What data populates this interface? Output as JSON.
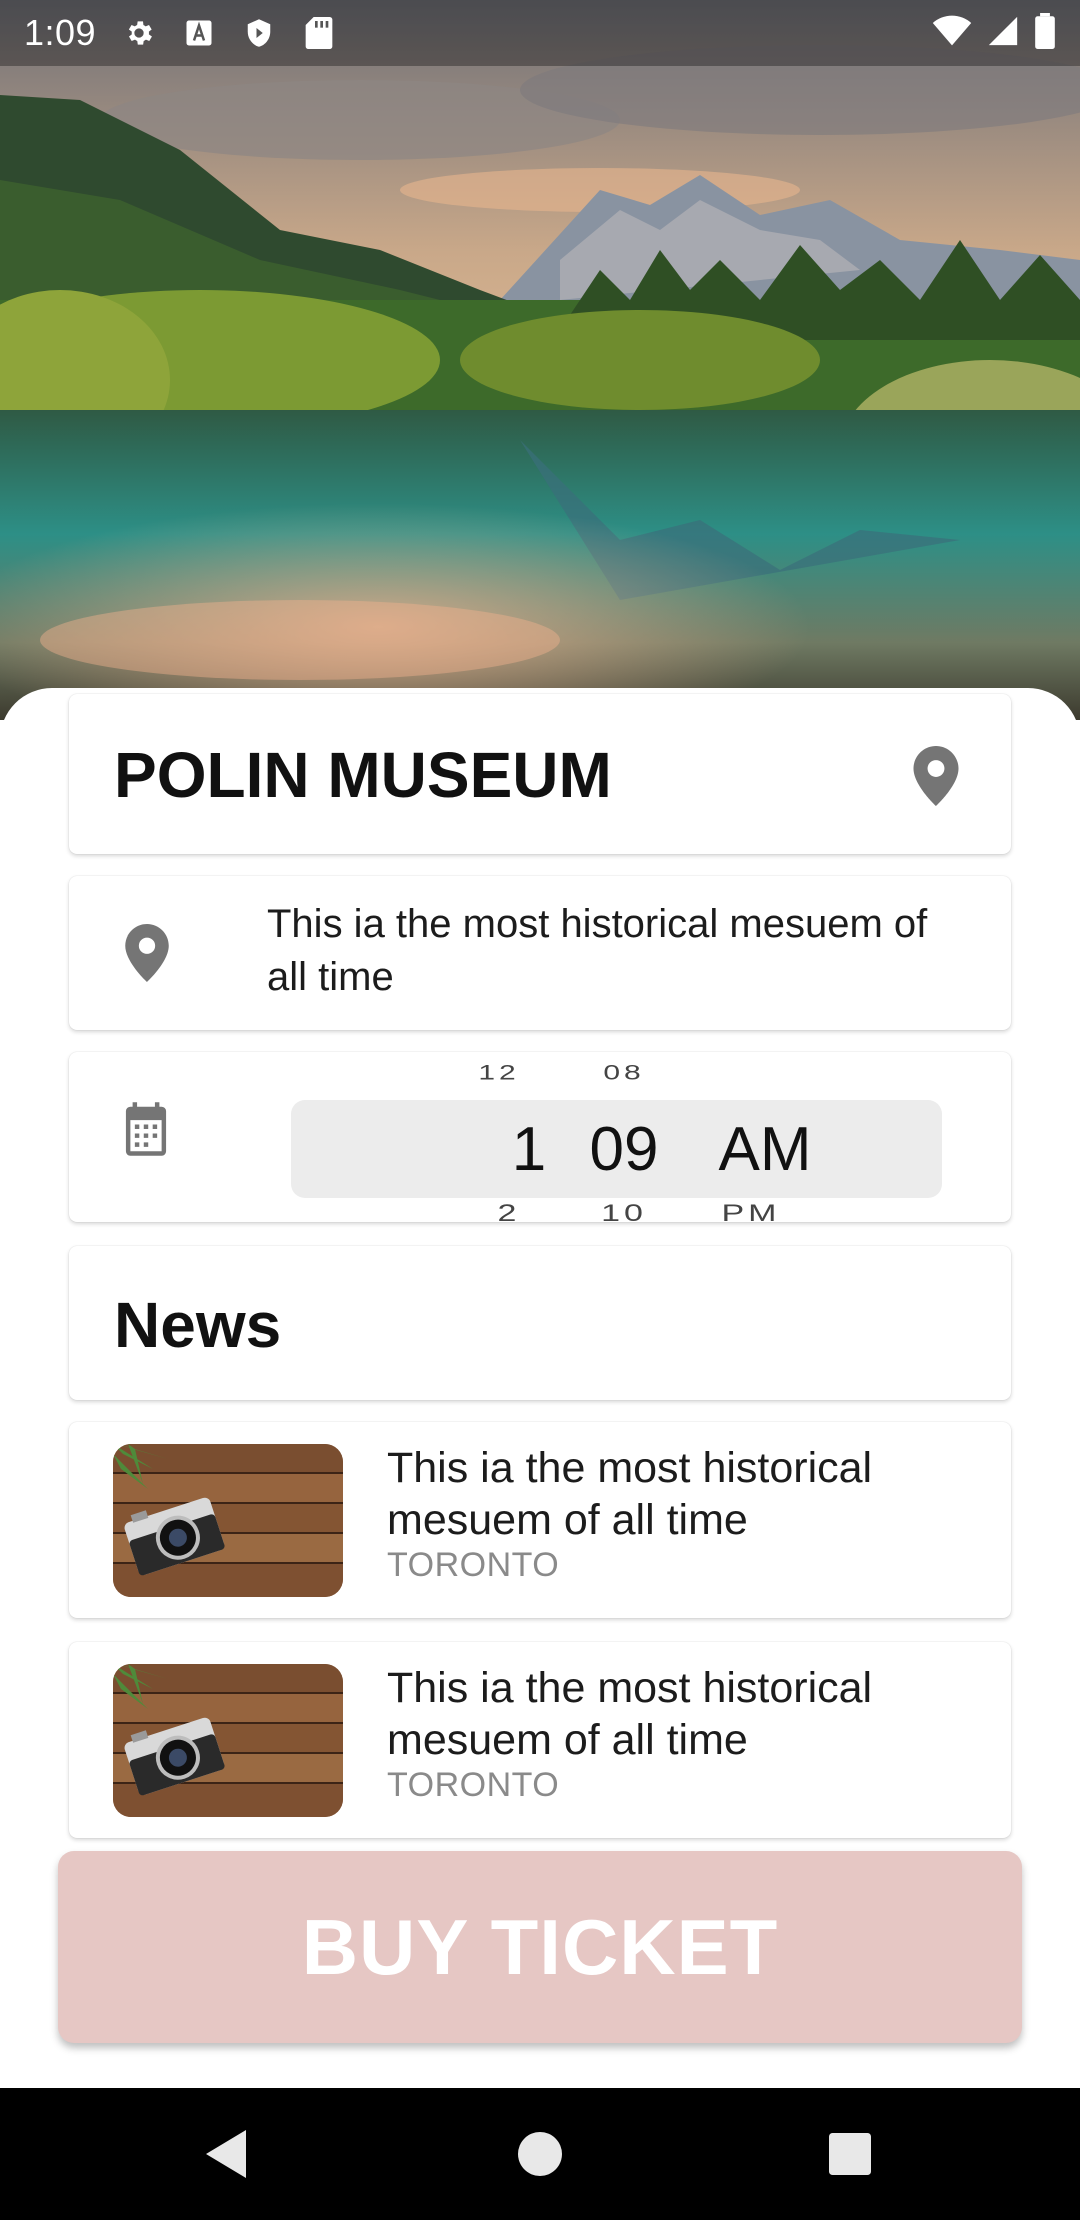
{
  "status_bar": {
    "time": "1:09",
    "left_icons": [
      "settings-gear-icon",
      "a-badge-icon",
      "shield-icon",
      "sd-card-icon"
    ],
    "right_icons": [
      "wifi-icon",
      "signal-icon",
      "battery-icon"
    ]
  },
  "hero": {
    "image": "mountain-lake-landscape"
  },
  "museum": {
    "title": "POLIN MUSEUM"
  },
  "description": {
    "text": "This ia the most historical mesuem of all time"
  },
  "time_picker": {
    "hour": {
      "prev": "12",
      "current": "1",
      "next": "2"
    },
    "minute": {
      "prev": "08",
      "current": "09",
      "next": "10"
    },
    "ampm": {
      "prev": "",
      "current": "AM",
      "next": "PM"
    }
  },
  "news": {
    "heading": "News",
    "items": [
      {
        "title": "This ia the most historical mesuem of all time",
        "location": "TORONTO",
        "thumbnail": "camera-on-wood"
      },
      {
        "title": "This ia the most historical mesuem of all time",
        "location": "TORONTO",
        "thumbnail": "camera-on-wood"
      }
    ]
  },
  "buy_button": {
    "label": "BUY TICKET",
    "color": "#e6c7c4"
  },
  "nav_bar": {
    "buttons": [
      "back-icon",
      "home-icon",
      "recents-icon"
    ]
  }
}
